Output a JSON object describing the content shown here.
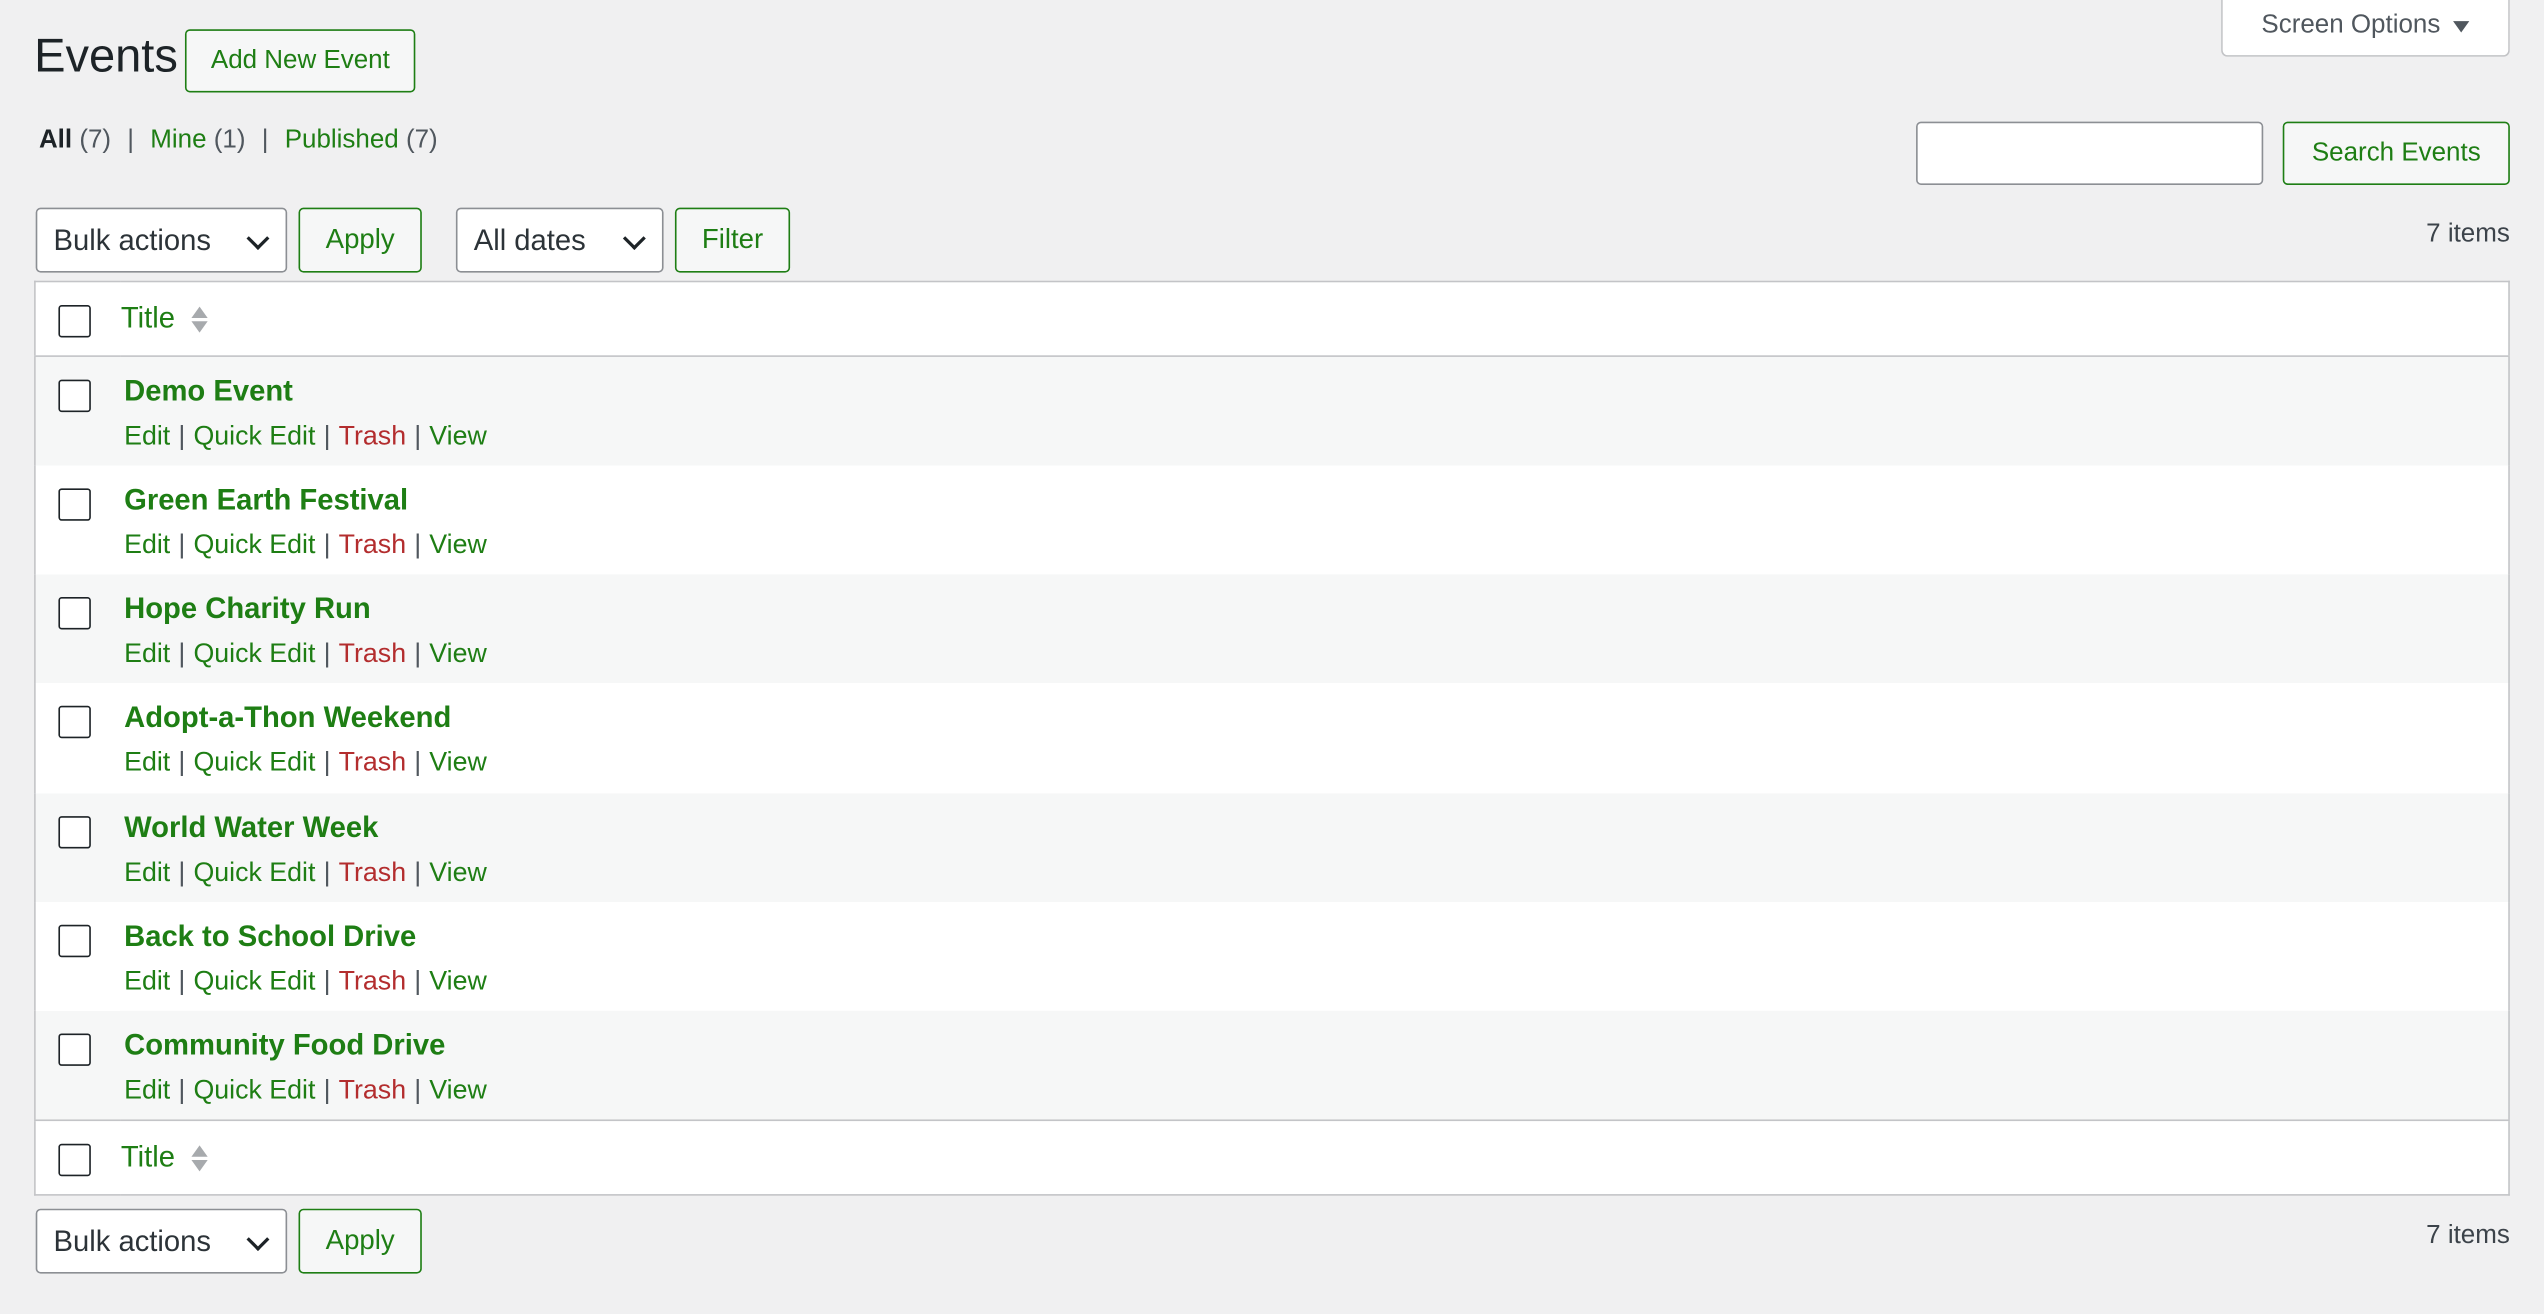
{
  "header": {
    "title": "Events",
    "add_new_label": "Add New Event",
    "screen_options_label": "Screen Options"
  },
  "filters": {
    "all_label": "All",
    "all_count": "(7)",
    "mine_label": "Mine",
    "mine_count": "(1)",
    "published_label": "Published",
    "published_count": "(7)"
  },
  "search": {
    "value": "",
    "button_label": "Search Events"
  },
  "tablenav_top": {
    "bulk_actions_selected": "Bulk actions",
    "apply_label": "Apply",
    "dates_selected": "All dates",
    "filter_label": "Filter",
    "items_count": "7 items"
  },
  "table": {
    "column_title": "Title",
    "row_actions": {
      "edit": "Edit",
      "quick_edit": "Quick Edit",
      "trash": "Trash",
      "view": "View",
      "separator": "|"
    },
    "rows": [
      {
        "title": "Demo Event"
      },
      {
        "title": "Green Earth Festival"
      },
      {
        "title": "Hope Charity Run"
      },
      {
        "title": "Adopt-a-Thon Weekend"
      },
      {
        "title": "World Water Week"
      },
      {
        "title": "Back to School Drive"
      },
      {
        "title": "Community Food Drive"
      }
    ]
  },
  "tablenav_bottom": {
    "bulk_actions_selected": "Bulk actions",
    "apply_label": "Apply",
    "items_count": "7 items"
  },
  "colors": {
    "accent": "#1e7e14",
    "trash": "#b32d2e",
    "background": "#f0f0f1"
  }
}
